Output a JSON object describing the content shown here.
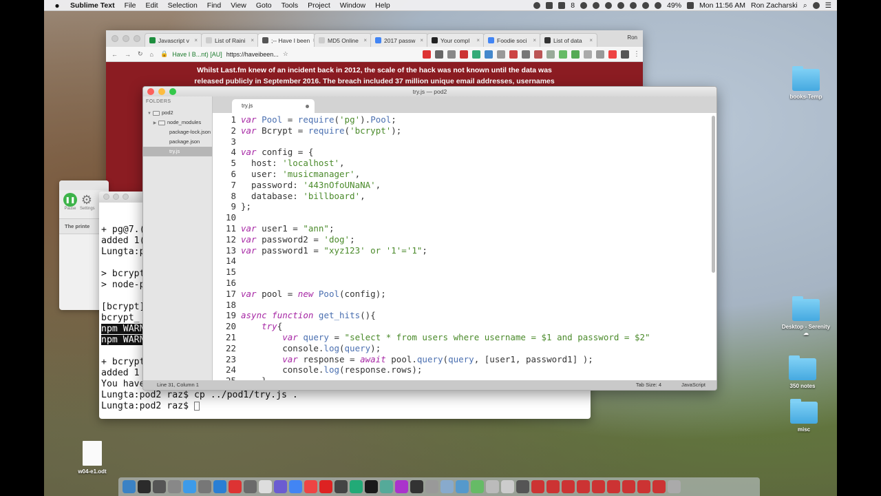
{
  "menubar": {
    "apple": "",
    "app_name": "Sublime Text",
    "items": [
      "File",
      "Edit",
      "Selection",
      "Find",
      "View",
      "Goto",
      "Tools",
      "Project",
      "Window",
      "Help"
    ],
    "status": {
      "notif_count": "8",
      "battery": "49%",
      "clock": "Mon 11:56 AM",
      "user": "Ron Zacharski"
    }
  },
  "browser": {
    "tabs": [
      {
        "label": "Javascript v",
        "color": "#1e8e3e"
      },
      {
        "label": "List of Raini",
        "color": "#cccccc"
      },
      {
        "label": ";-- Have I been",
        "color": "#555555"
      },
      {
        "label": "MD5 Online",
        "color": "#cccccc"
      },
      {
        "label": "2017 passw",
        "color": "#4285f4"
      },
      {
        "label": "Your compl",
        "color": "#222222"
      },
      {
        "label": "Foodie soci",
        "color": "#4285f4"
      },
      {
        "label": "List of data",
        "color": "#333333"
      }
    ],
    "profile": "Ron",
    "site_name": "Have I B...nt) [AU]",
    "url": "https://haveibeen...",
    "content": "Whilst Last.fm knew of an incident back in 2012, the scale of the hack was not known until the data was released publicly in September 2016. The breach included 37 million unique email addresses, usernames and"
  },
  "smallwin": {
    "pause_label": "Pause",
    "settings_label": "Settings",
    "message": "The printe"
  },
  "terminal": {
    "lines": [
      "+ pg@7.(",
      "added 1(",
      "Lungta:p",
      "",
      "> bcrypt",
      "> node-p",
      "",
      "[bcrypt]",
      "bcrypt_",
      "npm WARN",
      "npm WARN",
      "",
      "+ bcrypt",
      "added 1",
      "You have new mail in /var/mail/raz",
      "Lungta:pod2 raz$ cp ../pod1/try.js .",
      "Lungta:pod2 raz$ "
    ]
  },
  "sublime": {
    "title": "try.js — pod2",
    "sidebar_header": "FOLDERS",
    "tree": [
      {
        "label": "pod2",
        "indent": 0,
        "arrow": "▼",
        "folder": true
      },
      {
        "label": "node_modules",
        "indent": 1,
        "arrow": "▶",
        "folder": true
      },
      {
        "label": "package-lock.json",
        "indent": 1,
        "arrow": "",
        "folder": false
      },
      {
        "label": "package.json",
        "indent": 1,
        "arrow": "",
        "folder": false
      },
      {
        "label": "try.js",
        "indent": 1,
        "arrow": "",
        "folder": false,
        "selected": true
      }
    ],
    "tab_label": "try.js",
    "status_left": "Line 31, Column 1",
    "tab_size": "Tab Size: 4",
    "syntax": "JavaScript",
    "code": [
      "var Pool = require('pg').Pool;",
      "var Bcrypt = require('bcrypt');",
      "",
      "var config = {",
      "  host: 'localhost',",
      "  user: 'musicmanager',",
      "  password: '443nOfoUNaNA',",
      "  database: 'billboard',",
      "};",
      "",
      "var user1 = \"ann\";",
      "var password2 = 'dog';",
      "var password1 = \"xyz123' or '1'='1\";",
      "",
      "",
      "",
      "var pool = new Pool(config);",
      "",
      "async function get_hits(){",
      "    try{",
      "        var query = \"select * from users where username = $1 and password = $2\"",
      "        console.log(query);",
      "        var response = await pool.query(query, [user1, password1] );",
      "        console.log(response.rows);",
      "    }"
    ]
  },
  "desktop": {
    "icons": [
      "books-Temp",
      "Desktop - Serenity ☁",
      "350 notes",
      "misc",
      "w04-e1.odt"
    ]
  },
  "dock": {
    "apps": [
      "#3b82c4",
      "#2b2b2b",
      "#555",
      "#888",
      "#3d9be9",
      "#777",
      "#2a7fd4",
      "#d33",
      "#6a6a6a",
      "#ddd",
      "#6b5cd1",
      "#4285f4",
      "#e44",
      "#d22",
      "#444",
      "#2a7",
      "#1a1a1a",
      "#5a9",
      "#a3c",
      "#333",
      "#999",
      "#8ac",
      "#59c",
      "#6b6",
      "#bbb",
      "#ccc",
      "#555",
      "#c33",
      "#c33",
      "#c33",
      "#c33",
      "#c33",
      "#c33",
      "#c33",
      "#c33",
      "#c33",
      "#aaa"
    ]
  }
}
